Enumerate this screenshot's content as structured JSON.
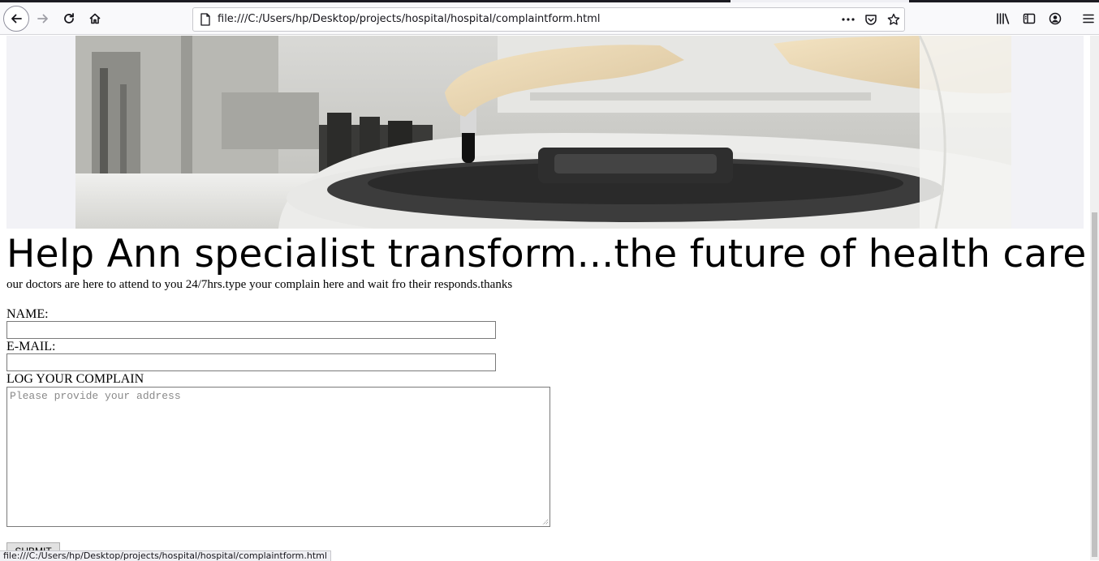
{
  "browser": {
    "url": "file:///C:/Users/hp/Desktop/projects/hospital/hospital/complaintform.html",
    "status_url": "file:///C:/Users/hp/Desktop/projects/hospital/hospital/complaintform.html",
    "icons": [
      "back-icon",
      "forward-icon",
      "reload-icon",
      "home-icon",
      "page-icon",
      "more-icon",
      "pocket-icon",
      "bookmark-star-icon",
      "library-icon",
      "sidebar-icon",
      "account-icon",
      "menu-icon"
    ]
  },
  "page": {
    "banner_alt": "lab centrifuge with gloved hands holding blood sample",
    "headline": "Help Ann specialist transform...the future of health care",
    "intro": "our doctors are here to attend to you 24/7hrs.type your complain here and wait fro their responds.thanks",
    "form": {
      "name_label": "NAME:",
      "name_value": "",
      "email_label": "E-MAIL:",
      "email_value": "",
      "complain_label": "LOG YOUR COMPLAIN",
      "complain_placeholder": "Please provide your address",
      "submit_label": "SUBMIT"
    }
  },
  "colors": {
    "toolbar_bg": "#f9f9fb",
    "tabstrip_bg": "#1c1b22",
    "banner_bg": "#f2f2f6"
  }
}
